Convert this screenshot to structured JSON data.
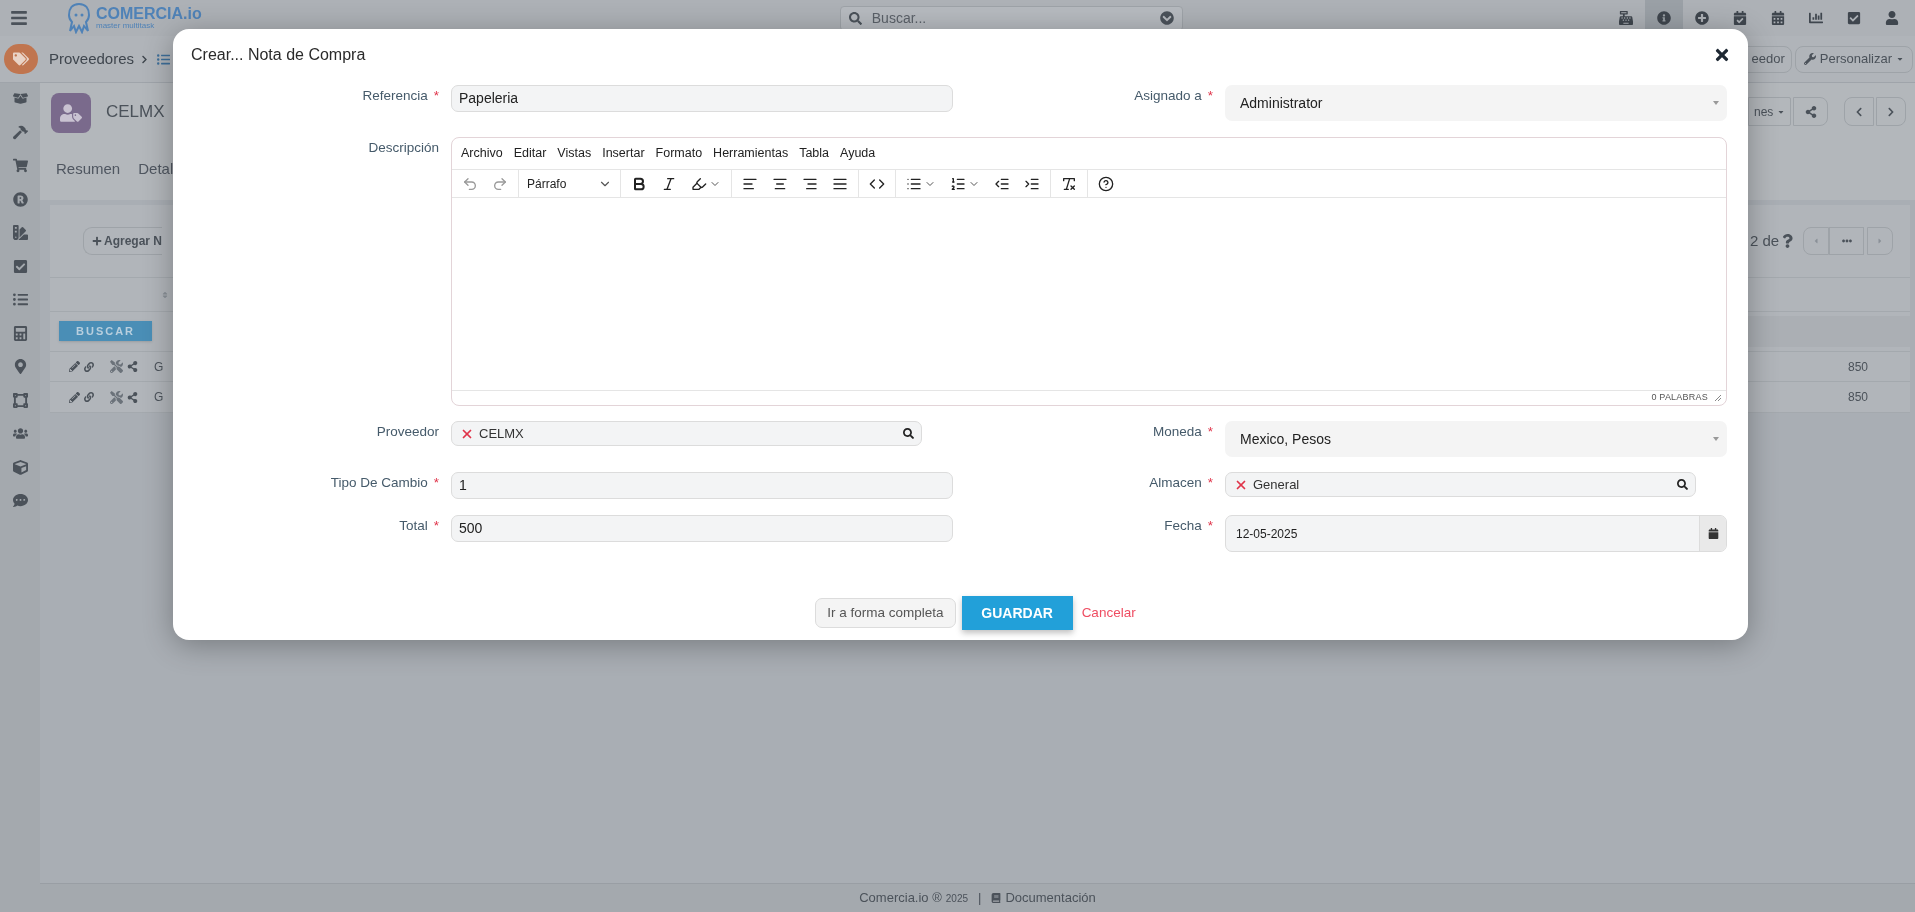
{
  "top_bar": {
    "logo": "COMERCIA.io",
    "tagline": "master multitask",
    "search": {
      "placeholder": "Buscar..."
    }
  },
  "breadcrumb": {
    "items": [
      "Proveedores"
    ],
    "buttons": [
      "eedor",
      "Personalizar"
    ]
  },
  "record": {
    "name": "CELMX",
    "tabs": [
      {
        "label": "Resumen",
        "selected": false
      },
      {
        "label": "Detal",
        "selected": false
      }
    ],
    "actions_button": "nes"
  },
  "list": {
    "add_button": "Agregar N",
    "search_button": "BUSCAR",
    "pager": "2 de",
    "rows": [
      {
        "column_1": "G",
        "column_2": "850"
      },
      {
        "column_1": "G",
        "column_2": "850"
      }
    ]
  },
  "modal": {
    "title": "Crear... Nota de Compra",
    "rows": [
      [
        {
          "kind": "text",
          "label": "Referencia",
          "marker": "*",
          "value": "Papeleria"
        },
        {
          "kind": "select",
          "label": "Asignado a",
          "marker": "*",
          "value": "Administrator"
        }
      ],
      [
        {
          "kind": "editor",
          "label": "Descripción",
          "menu": [
            "Archivo",
            "Editar",
            "Vistas",
            "Insertar",
            "Formato",
            "Herramientas",
            "Tabla",
            "Ayuda"
          ],
          "block_format": "Párrafo",
          "word_count": "0 PALABRAS"
        }
      ],
      [
        {
          "kind": "lookup",
          "label": "Proveedor",
          "value": "CELMX"
        },
        {
          "kind": "select",
          "label": "Moneda",
          "marker": "*",
          "value": "Mexico, Pesos"
        }
      ],
      [
        {
          "kind": "text",
          "label": "Tipo De Cambio",
          "marker": "*",
          "value": "1"
        },
        {
          "kind": "lookup",
          "label": "Almacen",
          "marker": "*",
          "value": "General"
        }
      ],
      [
        {
          "kind": "text",
          "label": "Total",
          "marker": "*",
          "value": "500"
        },
        {
          "kind": "date",
          "label": "Fecha",
          "marker": "*",
          "value": "12-05-2025"
        }
      ]
    ],
    "buttons": {
      "full_form": "Ir a forma completa",
      "save": "GUARDAR",
      "cancel": "Cancelar"
    }
  },
  "footer": {
    "brand": "Comercia.io ®",
    "year": "2025",
    "separator": "|",
    "docs_link": "Documentación"
  }
}
